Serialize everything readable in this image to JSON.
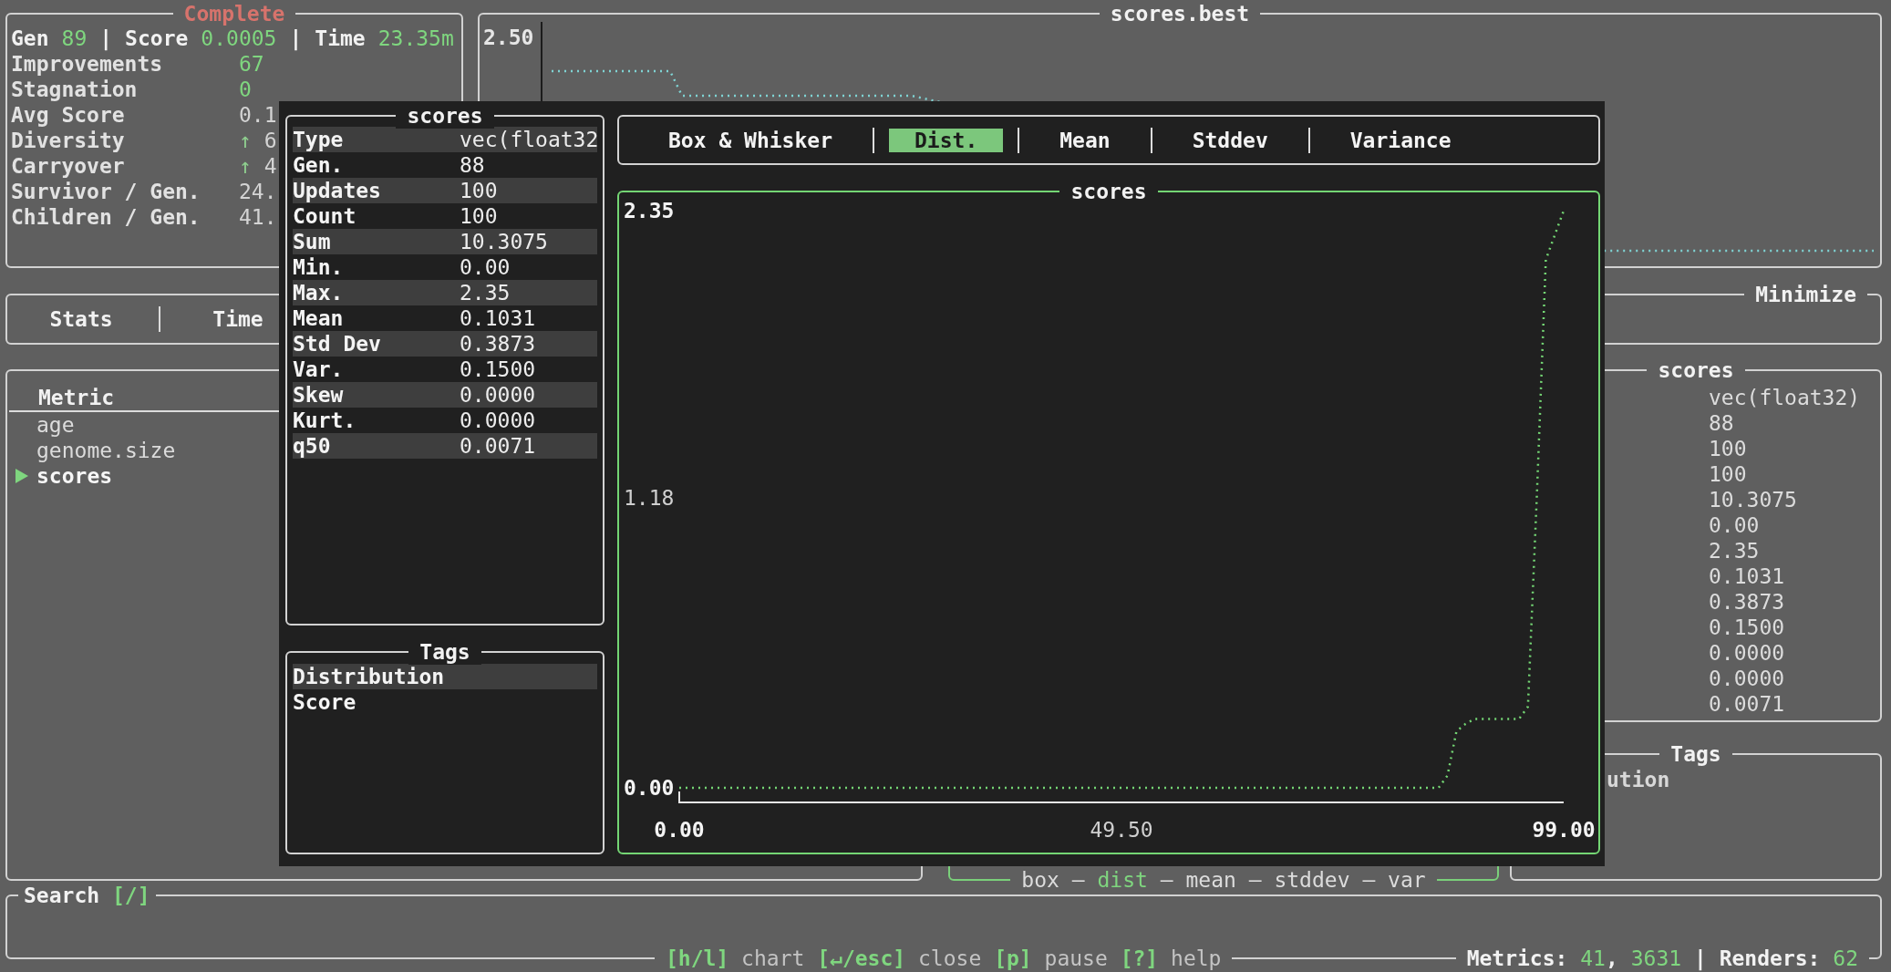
{
  "summary": {
    "status": "Complete",
    "separator": "|",
    "header": [
      {
        "label": "Gen",
        "value": "89"
      },
      {
        "label": "Score",
        "value": "0.0005"
      },
      {
        "label": "Time",
        "value": "23.35m"
      }
    ],
    "stats": [
      {
        "label": "Improvements",
        "value": "67",
        "highlight": true
      },
      {
        "label": "Stagnation",
        "value": "0",
        "highlight": true
      },
      {
        "label": "Avg Score",
        "value": "0.1",
        "highlight": false
      },
      {
        "label": "Diversity",
        "arrow": "↑",
        "value": "6",
        "highlight": false
      },
      {
        "label": "Carryover",
        "arrow": "↑",
        "value": "4",
        "highlight": false
      },
      {
        "label": "Survivor / Gen.",
        "value": "24.",
        "highlight": false
      },
      {
        "label": "Children / Gen.",
        "value": "41.",
        "highlight": false
      }
    ]
  },
  "best_chart": {
    "title": "scores.best",
    "y_label": "2.50"
  },
  "view_tabs": [
    {
      "label": "Stats",
      "selected": false
    },
    {
      "label": "Time",
      "selected": false
    }
  ],
  "objective": "Minimize",
  "metric_list": {
    "header": "Metric",
    "items": [
      {
        "name": "age",
        "selected": false
      },
      {
        "name": "genome.size",
        "selected": false
      },
      {
        "name": "scores",
        "selected": true
      }
    ]
  },
  "chart_switch": {
    "separator": "–",
    "items": [
      {
        "label": "box",
        "selected": false
      },
      {
        "label": "dist",
        "selected": true
      },
      {
        "label": "mean",
        "selected": false
      },
      {
        "label": "stddev",
        "selected": false
      },
      {
        "label": "var",
        "selected": false
      }
    ]
  },
  "detail_panel": {
    "title": "scores",
    "values": [
      "vec(float32)",
      "88",
      "100",
      "100",
      "10.3075",
      "0.00",
      "2.35",
      "0.1031",
      "0.3873",
      "0.1500",
      "0.0000",
      "0.0000",
      "0.0071"
    ]
  },
  "tags_panel": {
    "title": "Tags",
    "items": [
      "ution"
    ]
  },
  "search": {
    "label": "Search",
    "key": "[/]"
  },
  "status_bar": {
    "divider": "|",
    "hints": [
      {
        "key": "[h/l]",
        "action": "chart"
      },
      {
        "key": "[↵/esc]",
        "action": "close"
      },
      {
        "key": "[p]",
        "action": "pause"
      },
      {
        "key": "[?]",
        "action": "help"
      }
    ],
    "counters": [
      {
        "label": "Metrics:",
        "values": [
          "41",
          "3631"
        ],
        "joiner": ","
      },
      {
        "label": "Renders:",
        "values": [
          "62"
        ]
      }
    ]
  },
  "modal": {
    "table": {
      "title": "scores",
      "rows": [
        {
          "label": "Type",
          "value": "vec(float32"
        },
        {
          "label": "Gen.",
          "value": "88"
        },
        {
          "label": "Updates",
          "value": "100"
        },
        {
          "label": "Count",
          "value": "100"
        },
        {
          "label": "Sum",
          "value": "10.3075"
        },
        {
          "label": "Min.",
          "value": "0.00"
        },
        {
          "label": "Max.",
          "value": "2.35"
        },
        {
          "label": "Mean",
          "value": "0.1031"
        },
        {
          "label": "Std Dev",
          "value": "0.3873"
        },
        {
          "label": "Var.",
          "value": "0.1500"
        },
        {
          "label": "Skew",
          "value": "0.0000"
        },
        {
          "label": "Kurt.",
          "value": "0.0000"
        },
        {
          "label": "q50",
          "value": "0.0071"
        }
      ]
    },
    "tags": {
      "title": "Tags",
      "items": [
        {
          "label": "Distribution",
          "selected": true
        },
        {
          "label": "Score",
          "selected": false
        }
      ]
    },
    "chart_tabs": [
      {
        "label": "Box & Whisker",
        "selected": false
      },
      {
        "label": "Dist.",
        "selected": true
      },
      {
        "label": "Mean",
        "selected": false
      },
      {
        "label": "Stddev",
        "selected": false
      },
      {
        "label": "Variance",
        "selected": false
      }
    ],
    "chart": {
      "chart_data": {
        "type": "line",
        "title": "scores",
        "xlim": [
          0,
          99
        ],
        "ylim": [
          0,
          2.35
        ],
        "xticks": [
          {
            "value": 0,
            "label": "0.00"
          },
          {
            "value": 49.5,
            "label": "49.50"
          },
          {
            "value": 99,
            "label": "99.00"
          }
        ],
        "yticks": [
          {
            "value": 0,
            "label": "0.00"
          },
          {
            "value": 1.18,
            "label": "1.18"
          },
          {
            "value": 2.35,
            "label": "2.35"
          }
        ],
        "x": [
          0,
          1,
          2,
          3,
          4,
          5,
          6,
          7,
          8,
          9,
          10,
          11,
          12,
          13,
          14,
          15,
          16,
          17,
          18,
          19,
          20,
          21,
          22,
          23,
          24,
          25,
          26,
          27,
          28,
          29,
          30,
          31,
          32,
          33,
          34,
          35,
          36,
          37,
          38,
          39,
          40,
          41,
          42,
          43,
          44,
          45,
          46,
          47,
          48,
          49,
          50,
          51,
          52,
          53,
          54,
          55,
          56,
          57,
          58,
          59,
          60,
          61,
          62,
          63,
          64,
          65,
          66,
          67,
          68,
          69,
          70,
          71,
          72,
          73,
          74,
          75,
          76,
          77,
          78,
          79,
          80,
          81,
          82,
          83,
          84,
          85,
          86,
          87,
          88,
          89,
          90,
          91,
          92,
          93,
          94,
          95,
          96,
          97,
          98,
          99
        ],
        "series": [
          {
            "color": "#74d674",
            "line_style": "dotted",
            "values": [
              0,
              0,
              0,
              0,
              0,
              0,
              0,
              0,
              0,
              0,
              0,
              0,
              0,
              0,
              0,
              0,
              0,
              0,
              0,
              0,
              0,
              0,
              0,
              0,
              0,
              0,
              0,
              0,
              0,
              0,
              0,
              0,
              0,
              0,
              0,
              0,
              0,
              0,
              0,
              0,
              0,
              0,
              0,
              0,
              0,
              0,
              0,
              0,
              0,
              0,
              0,
              0,
              0,
              0,
              0,
              0,
              0,
              0,
              0,
              0,
              0,
              0,
              0,
              0,
              0,
              0,
              0,
              0,
              0,
              0,
              0,
              0,
              0,
              0,
              0,
              0,
              0,
              0,
              0,
              0,
              0,
              0,
              0,
              0,
              0,
              0,
              0.05,
              0.23,
              0.26,
              0.28,
              0.28,
              0.28,
              0.28,
              0.28,
              0.28,
              0.33,
              1.19,
              2.15,
              2.25,
              2.35
            ]
          }
        ]
      }
    }
  }
}
